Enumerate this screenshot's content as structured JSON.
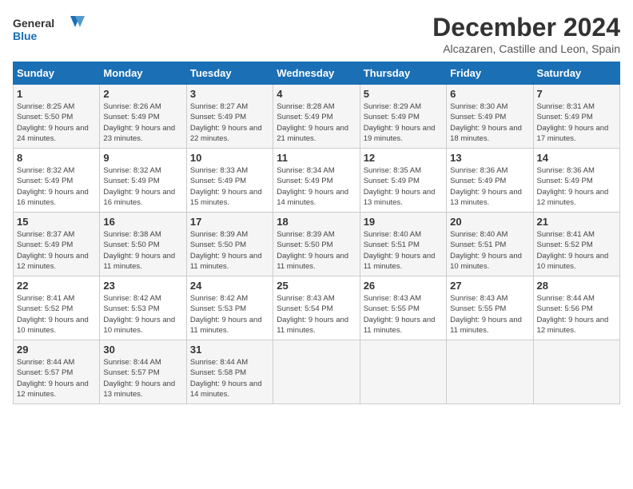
{
  "logo": {
    "line1": "General",
    "line2": "Blue"
  },
  "title": "December 2024",
  "subtitle": "Alcazaren, Castille and Leon, Spain",
  "days_of_week": [
    "Sunday",
    "Monday",
    "Tuesday",
    "Wednesday",
    "Thursday",
    "Friday",
    "Saturday"
  ],
  "weeks": [
    [
      {
        "day": "1",
        "sunrise": "8:25 AM",
        "sunset": "5:50 PM",
        "daylight": "9 hours and 24 minutes."
      },
      {
        "day": "2",
        "sunrise": "8:26 AM",
        "sunset": "5:49 PM",
        "daylight": "9 hours and 23 minutes."
      },
      {
        "day": "3",
        "sunrise": "8:27 AM",
        "sunset": "5:49 PM",
        "daylight": "9 hours and 22 minutes."
      },
      {
        "day": "4",
        "sunrise": "8:28 AM",
        "sunset": "5:49 PM",
        "daylight": "9 hours and 21 minutes."
      },
      {
        "day": "5",
        "sunrise": "8:29 AM",
        "sunset": "5:49 PM",
        "daylight": "9 hours and 19 minutes."
      },
      {
        "day": "6",
        "sunrise": "8:30 AM",
        "sunset": "5:49 PM",
        "daylight": "9 hours and 18 minutes."
      },
      {
        "day": "7",
        "sunrise": "8:31 AM",
        "sunset": "5:49 PM",
        "daylight": "9 hours and 17 minutes."
      }
    ],
    [
      {
        "day": "8",
        "sunrise": "8:32 AM",
        "sunset": "5:49 PM",
        "daylight": "9 hours and 16 minutes."
      },
      {
        "day": "9",
        "sunrise": "8:32 AM",
        "sunset": "5:49 PM",
        "daylight": "9 hours and 16 minutes."
      },
      {
        "day": "10",
        "sunrise": "8:33 AM",
        "sunset": "5:49 PM",
        "daylight": "9 hours and 15 minutes."
      },
      {
        "day": "11",
        "sunrise": "8:34 AM",
        "sunset": "5:49 PM",
        "daylight": "9 hours and 14 minutes."
      },
      {
        "day": "12",
        "sunrise": "8:35 AM",
        "sunset": "5:49 PM",
        "daylight": "9 hours and 13 minutes."
      },
      {
        "day": "13",
        "sunrise": "8:36 AM",
        "sunset": "5:49 PM",
        "daylight": "9 hours and 13 minutes."
      },
      {
        "day": "14",
        "sunrise": "8:36 AM",
        "sunset": "5:49 PM",
        "daylight": "9 hours and 12 minutes."
      }
    ],
    [
      {
        "day": "15",
        "sunrise": "8:37 AM",
        "sunset": "5:49 PM",
        "daylight": "9 hours and 12 minutes."
      },
      {
        "day": "16",
        "sunrise": "8:38 AM",
        "sunset": "5:50 PM",
        "daylight": "9 hours and 11 minutes."
      },
      {
        "day": "17",
        "sunrise": "8:39 AM",
        "sunset": "5:50 PM",
        "daylight": "9 hours and 11 minutes."
      },
      {
        "day": "18",
        "sunrise": "8:39 AM",
        "sunset": "5:50 PM",
        "daylight": "9 hours and 11 minutes."
      },
      {
        "day": "19",
        "sunrise": "8:40 AM",
        "sunset": "5:51 PM",
        "daylight": "9 hours and 11 minutes."
      },
      {
        "day": "20",
        "sunrise": "8:40 AM",
        "sunset": "5:51 PM",
        "daylight": "9 hours and 10 minutes."
      },
      {
        "day": "21",
        "sunrise": "8:41 AM",
        "sunset": "5:52 PM",
        "daylight": "9 hours and 10 minutes."
      }
    ],
    [
      {
        "day": "22",
        "sunrise": "8:41 AM",
        "sunset": "5:52 PM",
        "daylight": "9 hours and 10 minutes."
      },
      {
        "day": "23",
        "sunrise": "8:42 AM",
        "sunset": "5:53 PM",
        "daylight": "9 hours and 10 minutes."
      },
      {
        "day": "24",
        "sunrise": "8:42 AM",
        "sunset": "5:53 PM",
        "daylight": "9 hours and 11 minutes."
      },
      {
        "day": "25",
        "sunrise": "8:43 AM",
        "sunset": "5:54 PM",
        "daylight": "9 hours and 11 minutes."
      },
      {
        "day": "26",
        "sunrise": "8:43 AM",
        "sunset": "5:55 PM",
        "daylight": "9 hours and 11 minutes."
      },
      {
        "day": "27",
        "sunrise": "8:43 AM",
        "sunset": "5:55 PM",
        "daylight": "9 hours and 11 minutes."
      },
      {
        "day": "28",
        "sunrise": "8:44 AM",
        "sunset": "5:56 PM",
        "daylight": "9 hours and 12 minutes."
      }
    ],
    [
      {
        "day": "29",
        "sunrise": "8:44 AM",
        "sunset": "5:57 PM",
        "daylight": "9 hours and 12 minutes."
      },
      {
        "day": "30",
        "sunrise": "8:44 AM",
        "sunset": "5:57 PM",
        "daylight": "9 hours and 13 minutes."
      },
      {
        "day": "31",
        "sunrise": "8:44 AM",
        "sunset": "5:58 PM",
        "daylight": "9 hours and 14 minutes."
      },
      null,
      null,
      null,
      null
    ]
  ]
}
